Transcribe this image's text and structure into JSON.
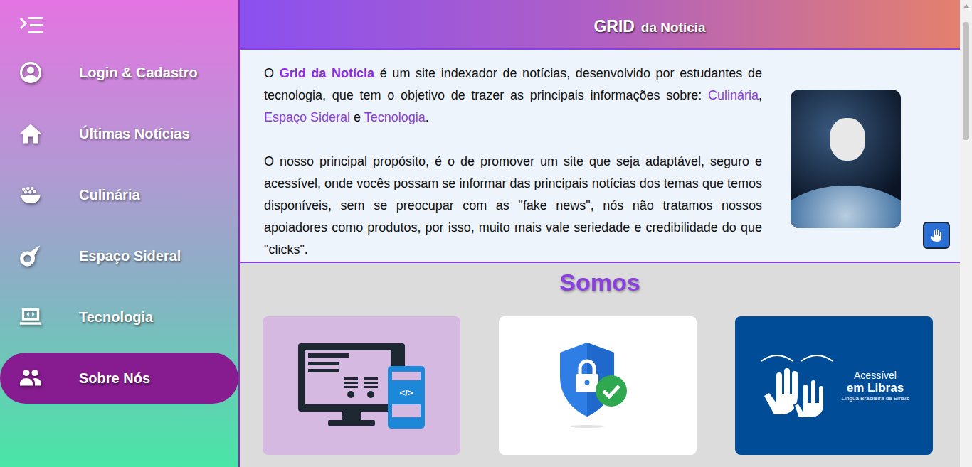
{
  "header": {
    "title_bold": "GRID",
    "title_rest": "da Notícia"
  },
  "sidebar": {
    "items": [
      {
        "label": "Login & Cadastro",
        "selected": false
      },
      {
        "label": "Últimas Notícias",
        "selected": false
      },
      {
        "label": "Culinária",
        "selected": false
      },
      {
        "label": "Espaço Sideral",
        "selected": false
      },
      {
        "label": "Tecnologia",
        "selected": false
      },
      {
        "label": "Sobre Nós",
        "selected": true
      }
    ]
  },
  "intro": {
    "paragraphs": [
      [
        {
          "text": "O ",
          "kind": "plain"
        },
        {
          "text": "Grid da Notícia",
          "kind": "brand"
        },
        {
          "text": " é um site indexador de notícias, desenvolvido por estudantes de tecnologia, que tem o objetivo de trazer as principais informações sobre: ",
          "kind": "plain"
        },
        {
          "text": "Culinária",
          "kind": "link"
        },
        {
          "text": ", ",
          "kind": "plain"
        },
        {
          "text": "Espaço Sideral",
          "kind": "link"
        },
        {
          "text": " e ",
          "kind": "plain"
        },
        {
          "text": "Tecnologia",
          "kind": "link"
        },
        {
          "text": ".",
          "kind": "plain"
        }
      ],
      [
        {
          "text": "O nosso principal propósito, é o de promover um site que seja adaptável, seguro e acessível, onde vocês possam se informar das principais notícias dos temas que temos disponíveis, sem se preocupar com as \"fake news\", nós não tratamos nossos apoiadores como produtos, por isso, muito mais vale seriedade e credibilidade do que \"clicks\".",
          "kind": "plain"
        }
      ]
    ]
  },
  "section": {
    "heading": "Somos",
    "cards": [
      {
        "kind": "responsive",
        "color": "#d5b9e1",
        "texts": [
          "</>"
        ]
      },
      {
        "kind": "security",
        "color": "#ffffff",
        "texts": []
      },
      {
        "kind": "libras",
        "color": "#004c97",
        "texts": [
          "Acessível",
          "em Libras",
          "Língua Brasileira de Sinais"
        ]
      }
    ]
  }
}
